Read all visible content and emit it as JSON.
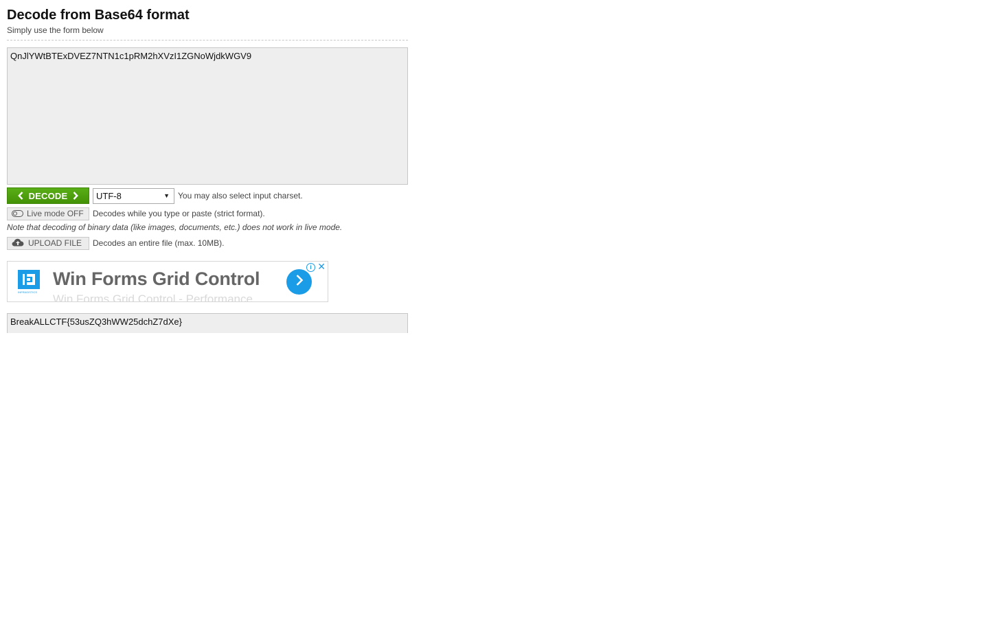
{
  "header": {
    "title": "Decode from Base64 format",
    "subtitle": "Simply use the form below"
  },
  "input": {
    "value": "QnJlYWtBTExDVEZ7NTN1c1pRM2hXVzI1ZGNoWjdkWGV9"
  },
  "decode": {
    "button_label": "DECODE",
    "charset_value": "UTF-8",
    "charset_hint": "You may also select input charset."
  },
  "live_mode": {
    "button_label": "Live mode OFF",
    "description": "Decodes while you type or paste (strict format).",
    "note": "Note that decoding of binary data (like images, documents, etc.) does not work in live mode."
  },
  "upload": {
    "button_label": "UPLOAD FILE",
    "description": "Decodes an entire file (max. 10MB)."
  },
  "ad": {
    "title": "Win Forms Grid Control",
    "subtitle": "Win Forms Grid Control - Performance",
    "logo_text": "INFRAGISTICS",
    "info_glyph": "i",
    "close_glyph": "✕"
  },
  "output": {
    "value": "BreakALLCTF{53usZQ3hWW25dchZ7dXe}"
  },
  "colors": {
    "decode_button": "#4c9e10",
    "ad_accent": "#1a9ce6",
    "field_background": "#eeeeee"
  },
  "icons": {
    "decode_left": "chevron-left-icon",
    "decode_right": "chevron-right-icon",
    "live_mode": "toggle-off-icon",
    "upload": "cloud-upload-icon",
    "ad_arrow": "chevron-right-icon"
  }
}
